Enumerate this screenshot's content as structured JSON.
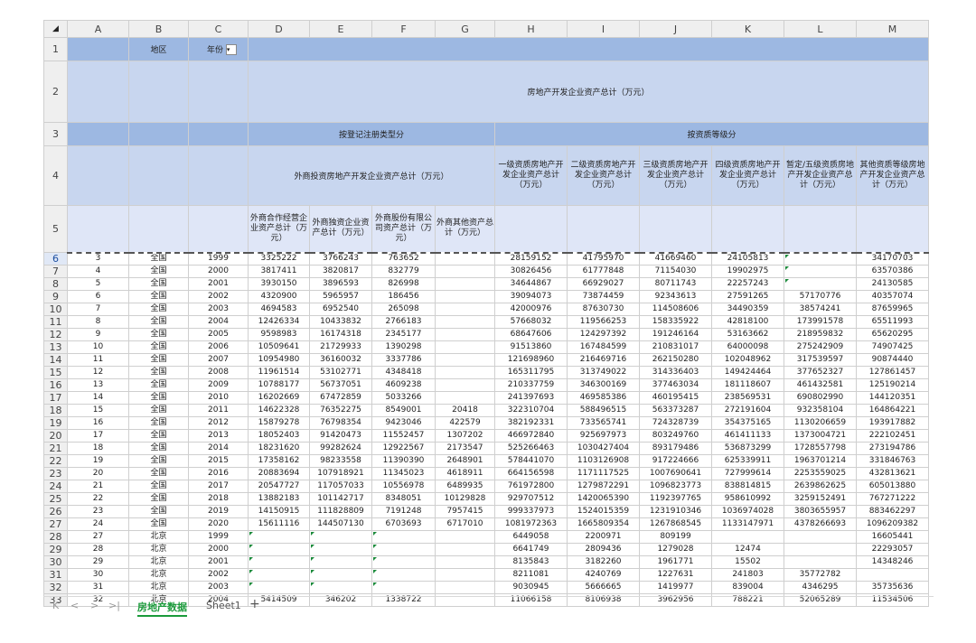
{
  "columns": [
    "A",
    "B",
    "C",
    "D",
    "E",
    "F",
    "G",
    "H",
    "I",
    "J",
    "K",
    "L",
    "M"
  ],
  "header": {
    "r1": {
      "b": "地区",
      "c": "年份"
    },
    "r2": {
      "title": "房地产开发企业资产总计（万元）"
    },
    "r3": {
      "by_reg": "按登记注册类型分",
      "by_qual": "按资质等级分"
    },
    "r4": {
      "foreign": "外商投资房地产开发企业资产总计（万元）",
      "h": "一级资质房地产开发企业资产总计（万元）",
      "i": "二级资质房地产开发企业资产总计（万元）",
      "j": "三级资质房地产开发企业资产总计（万元）",
      "k": "四级资质房地产开发企业资产总计（万元）",
      "l": "暂定/五级资质房地产开发企业资产总计（万元）",
      "m": "其他资质等级房地产开发企业资产总计（万元）"
    },
    "r5": {
      "d": "外商合作经营企业资产总计（万元）",
      "e": "外商独资企业资产总计（万元）",
      "f": "外商股份有限公司资产总计（万元）",
      "g": "外商其他资产总计（万元）"
    }
  },
  "rows": [
    [
      "6",
      "3",
      "全国",
      "1999",
      "3325222",
      "3766243",
      "763652",
      "",
      "28159152",
      "41795970",
      "41669460",
      "24105813",
      "",
      "34170703"
    ],
    [
      "7",
      "4",
      "全国",
      "2000",
      "3817411",
      "3820817",
      "832779",
      "",
      "30826456",
      "61777848",
      "71154030",
      "19902975",
      "",
      "63570386"
    ],
    [
      "8",
      "5",
      "全国",
      "2001",
      "3930150",
      "3896593",
      "826998",
      "",
      "34644867",
      "66929027",
      "80711743",
      "22257243",
      "",
      "24130585"
    ],
    [
      "9",
      "6",
      "全国",
      "2002",
      "4320900",
      "5965957",
      "186456",
      "",
      "39094073",
      "73874459",
      "92343613",
      "27591265",
      "57170776",
      "40357074"
    ],
    [
      "10",
      "7",
      "全国",
      "2003",
      "4694583",
      "6952540",
      "265098",
      "",
      "42000976",
      "87630730",
      "114508606",
      "34490359",
      "38574241",
      "87659965"
    ],
    [
      "11",
      "8",
      "全国",
      "2004",
      "12426334",
      "10433832",
      "2766183",
      "",
      "57668032",
      "119566253",
      "158335922",
      "42818100",
      "173991578",
      "65511993"
    ],
    [
      "12",
      "9",
      "全国",
      "2005",
      "9598983",
      "16174318",
      "2345177",
      "",
      "68647606",
      "124297392",
      "191246164",
      "53163662",
      "218959832",
      "65620295"
    ],
    [
      "13",
      "10",
      "全国",
      "2006",
      "10509641",
      "21729933",
      "1390298",
      "",
      "91513860",
      "167484599",
      "210831017",
      "64000098",
      "275242909",
      "74907425"
    ],
    [
      "14",
      "11",
      "全国",
      "2007",
      "10954980",
      "36160032",
      "3337786",
      "",
      "121698960",
      "216469716",
      "262150280",
      "102048962",
      "317539597",
      "90874440"
    ],
    [
      "15",
      "12",
      "全国",
      "2008",
      "11961514",
      "53102771",
      "4348418",
      "",
      "165311795",
      "313749022",
      "314336403",
      "149424464",
      "377652327",
      "127861457"
    ],
    [
      "16",
      "13",
      "全国",
      "2009",
      "10788177",
      "56737051",
      "4609238",
      "",
      "210337759",
      "346300169",
      "377463034",
      "181118607",
      "461432581",
      "125190214"
    ],
    [
      "17",
      "14",
      "全国",
      "2010",
      "16202669",
      "67472859",
      "5033266",
      "",
      "241397693",
      "469585386",
      "460195415",
      "238569531",
      "690802990",
      "144120351"
    ],
    [
      "18",
      "15",
      "全国",
      "2011",
      "14622328",
      "76352275",
      "8549001",
      "20418",
      "322310704",
      "588496515",
      "563373287",
      "272191604",
      "932358104",
      "164864221"
    ],
    [
      "19",
      "16",
      "全国",
      "2012",
      "15879278",
      "76798354",
      "9423046",
      "422579",
      "382192331",
      "733565741",
      "724328739",
      "354375165",
      "1130206659",
      "193917882"
    ],
    [
      "20",
      "17",
      "全国",
      "2013",
      "18052403",
      "91420473",
      "11552457",
      "1307202",
      "466972840",
      "925697973",
      "803249760",
      "461411133",
      "1373004721",
      "222102451"
    ],
    [
      "21",
      "18",
      "全国",
      "2014",
      "18231620",
      "99282624",
      "12922567",
      "2173547",
      "525266463",
      "1030427404",
      "893179486",
      "536873299",
      "1728557798",
      "273194786"
    ],
    [
      "22",
      "19",
      "全国",
      "2015",
      "17358162",
      "98233558",
      "11390390",
      "2648901",
      "578441070",
      "1103126908",
      "917224666",
      "625339911",
      "1963701214",
      "331846763"
    ],
    [
      "23",
      "20",
      "全国",
      "2016",
      "20883694",
      "107918921",
      "11345023",
      "4618911",
      "664156598",
      "1171117525",
      "1007690641",
      "727999614",
      "2253559025",
      "432813621"
    ],
    [
      "24",
      "21",
      "全国",
      "2017",
      "20547727",
      "117057033",
      "10556978",
      "6489935",
      "761972800",
      "1279872291",
      "1096823773",
      "838814815",
      "2639862625",
      "605013880"
    ],
    [
      "25",
      "22",
      "全国",
      "2018",
      "13882183",
      "101142717",
      "8348051",
      "10129828",
      "929707512",
      "1420065390",
      "1192397765",
      "958610992",
      "3259152491",
      "767271222"
    ],
    [
      "26",
      "23",
      "全国",
      "2019",
      "14150915",
      "111828809",
      "7191248",
      "7957415",
      "999337973",
      "1524015359",
      "1231910346",
      "1036974028",
      "3803655957",
      "883462297"
    ],
    [
      "27",
      "24",
      "全国",
      "2020",
      "15611116",
      "144507130",
      "6703693",
      "6717010",
      "1081972363",
      "1665809354",
      "1267868545",
      "1133147971",
      "4378266693",
      "1096209382"
    ],
    [
      "28",
      "27",
      "北京",
      "1999",
      "",
      "",
      "",
      "",
      "6449058",
      "2200971",
      "809199",
      "",
      "",
      "16605441"
    ],
    [
      "29",
      "28",
      "北京",
      "2000",
      "",
      "",
      "",
      "",
      "6641749",
      "2809436",
      "1279028",
      "12474",
      "",
      "22293057"
    ],
    [
      "30",
      "29",
      "北京",
      "2001",
      "",
      "",
      "",
      "",
      "8135843",
      "3182260",
      "1961771",
      "15502",
      "",
      "14348246"
    ],
    [
      "31",
      "30",
      "北京",
      "2002",
      "",
      "",
      "",
      "",
      "8211081",
      "4240769",
      "1227631",
      "241803",
      "35772782",
      ""
    ],
    [
      "32",
      "31",
      "北京",
      "2003",
      "",
      "",
      "",
      "",
      "9030945",
      "5666665",
      "1419977",
      "839004",
      "4346295",
      "35735636"
    ],
    [
      "33",
      "32",
      "北京",
      "2004",
      "5414509",
      "346202",
      "1338722",
      "",
      "11066158",
      "8106938",
      "3962956",
      "788221",
      "52065289",
      "11534506"
    ]
  ],
  "tabs": {
    "active": "房地产数据",
    "second": "Sheet1",
    "add": "+"
  },
  "nav": {
    "first": "K",
    "prev": "<",
    "next": ">",
    "last": ">|"
  }
}
